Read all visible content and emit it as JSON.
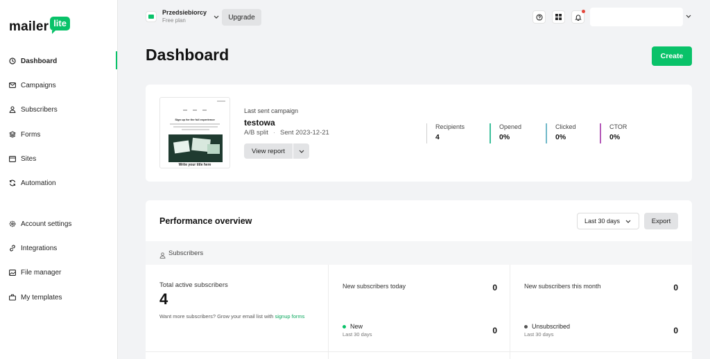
{
  "brand": {
    "logo_text": "mailer",
    "logo_badge": "lite",
    "accent": "#09c269"
  },
  "sidebar": {
    "items": [
      {
        "label": "Dashboard",
        "icon": "dashboard-icon"
      },
      {
        "label": "Campaigns",
        "icon": "mail-icon"
      },
      {
        "label": "Subscribers",
        "icon": "user-icon"
      },
      {
        "label": "Forms",
        "icon": "layers-icon"
      },
      {
        "label": "Sites",
        "icon": "browser-icon"
      },
      {
        "label": "Automation",
        "icon": "refresh-icon"
      },
      {
        "label": "Account settings",
        "icon": "gear-icon"
      },
      {
        "label": "Integrations",
        "icon": "link-icon"
      },
      {
        "label": "File manager",
        "icon": "image-icon"
      },
      {
        "label": "My templates",
        "icon": "briefcase-icon"
      }
    ],
    "active": "Dashboard"
  },
  "topbar": {
    "account_name": "Przedsiebiorcy",
    "account_plan": "Free plan",
    "upgrade_label": "Upgrade",
    "icons": [
      "help-icon",
      "apps-icon",
      "bell-icon"
    ]
  },
  "header": {
    "title": "Dashboard",
    "create_label": "Create"
  },
  "campaign": {
    "section_label": "Last sent campaign",
    "name": "testowa",
    "type": "A/B split",
    "sent": "Sent 2023-12-21",
    "view_report_label": "View report",
    "thumbnail": {
      "heading": "Sign up for the full experience",
      "footer": "Write your title here"
    },
    "stats": [
      {
        "label": "Recipients",
        "value": "4",
        "color": "#d0d0d0"
      },
      {
        "label": "Opened",
        "value": "0%",
        "color": "#3bbf9b"
      },
      {
        "label": "Clicked",
        "value": "0%",
        "color": "#6fb8c8"
      },
      {
        "label": "CTOR",
        "value": "0%",
        "color": "#b45ab8"
      }
    ]
  },
  "performance": {
    "title": "Performance overview",
    "range": "Last 30 days",
    "export_label": "Export",
    "section": "Subscribers",
    "total_label": "Total active subscribers",
    "total_value": "4",
    "hint_text": "Want more subscribers? Grow your email list with ",
    "hint_link": "signup forms",
    "today_label": "New subscribers today",
    "today_value": "0",
    "month_label": "New subscribers this month",
    "month_value": "0",
    "new_label": "New",
    "new_sub": "Last 30 days",
    "new_value": "0",
    "new_color": "#09c269",
    "unsub_label": "Unsubscribed",
    "unsub_sub": "Last 30 days",
    "unsub_value": "0",
    "unsub_color": "#555555"
  }
}
